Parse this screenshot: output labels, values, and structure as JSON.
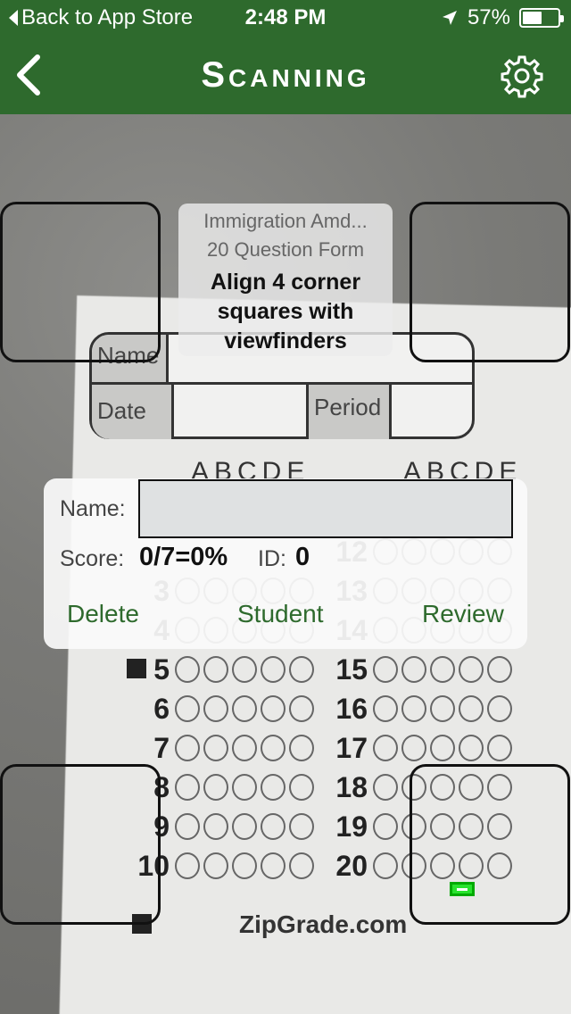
{
  "status_bar": {
    "back_label": "Back to App Store",
    "time": "2:48 PM",
    "battery": "57%",
    "battery_level": 0.57
  },
  "nav": {
    "title": "Scanning",
    "back_icon": "chevron-left-icon",
    "settings_icon": "gear-icon"
  },
  "instructions": {
    "form_name": "Immigration Amd...",
    "form_type": "20 Question Form",
    "message": "Align 4 corner squares with viewfinders"
  },
  "result": {
    "name_label": "Name:",
    "name_value": "",
    "score_label": "Score:",
    "score_value": "0/7=0%",
    "id_label": "ID:",
    "id_value": "0",
    "delete_label": "Delete",
    "student_label": "Student",
    "review_label": "Review"
  },
  "sheet": {
    "name_label": "Name",
    "date_label": "Date",
    "period_label": "Period",
    "col_header": "ABCDE",
    "left_questions": [
      "3",
      "4",
      "5",
      "6",
      "7",
      "8",
      "9",
      "10"
    ],
    "right_questions": [
      "12",
      "13",
      "14",
      "15",
      "16",
      "17",
      "18",
      "19",
      "20"
    ],
    "footer": "ZipGrade.com"
  },
  "colors": {
    "header_green": "#2e6a2d",
    "action_green": "#2e6a2d",
    "detect_green": "#29e32e"
  }
}
